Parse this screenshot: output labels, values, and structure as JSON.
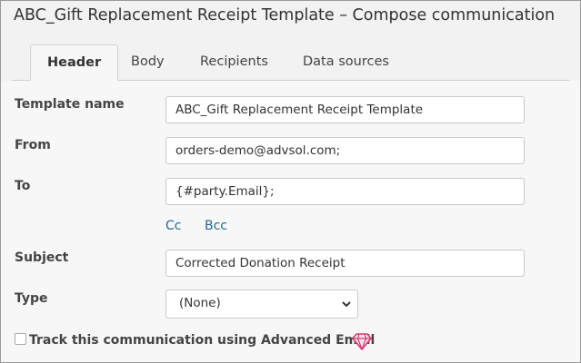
{
  "header": {
    "title": "ABC_Gift Replacement Receipt Template – Compose communication"
  },
  "tabs": [
    {
      "label": "Header",
      "active": true
    },
    {
      "label": "Body",
      "active": false
    },
    {
      "label": "Recipients",
      "active": false
    },
    {
      "label": "Data sources",
      "active": false
    }
  ],
  "form": {
    "template_name": {
      "label": "Template name",
      "value": "ABC_Gift Replacement Receipt Template"
    },
    "from": {
      "label": "From",
      "value": "orders-demo@advsol.com;"
    },
    "to": {
      "label": "To",
      "value": "{#party.Email};"
    },
    "cc_label": "Cc",
    "bcc_label": "Bcc",
    "subject": {
      "label": "Subject",
      "value": "Corrected Donation Receipt"
    },
    "type": {
      "label": "Type",
      "selected": "(None)"
    },
    "track": {
      "label": "Track this communication using Advanced Email",
      "checked": false
    }
  },
  "icons": {
    "premium": "gem-icon",
    "dropdown": "chevron-down-icon"
  },
  "colors": {
    "link": "#1f6a93",
    "gem": "#d23c73"
  }
}
